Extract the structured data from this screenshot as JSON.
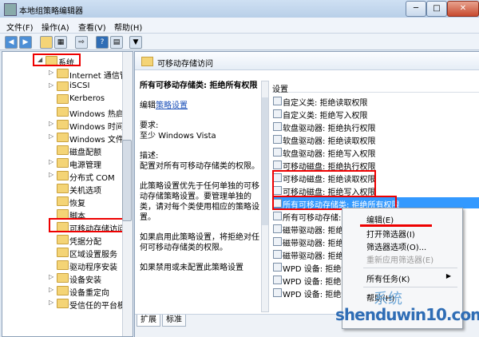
{
  "window": {
    "title": "本地组策略编辑器",
    "min_label": "─",
    "max_label": "□",
    "close_label": "✕"
  },
  "menu": [
    "文件(F)",
    "操作(A)",
    "查看(V)",
    "帮助(H)"
  ],
  "toolbar": [
    "back-icon",
    "forward-icon",
    "up-folder-icon",
    "show-hide-tree-icon",
    "export-icon",
    "help-icon",
    "properties-icon",
    "filter-icon"
  ],
  "tree": {
    "items": [
      {
        "label": "系统",
        "arrow": "◢"
      },
      {
        "label": "Internet 通信管",
        "arrow": "▷"
      },
      {
        "label": "iSCSI",
        "arrow": "▷"
      },
      {
        "label": "Kerberos",
        "arrow": ""
      },
      {
        "label": "Windows 热启",
        "arrow": ""
      },
      {
        "label": "Windows 时间",
        "arrow": "▷"
      },
      {
        "label": "Windows 文件",
        "arrow": "▷"
      },
      {
        "label": "磁盘配额",
        "arrow": ""
      },
      {
        "label": "电源管理",
        "arrow": "▷"
      },
      {
        "label": "分布式 COM",
        "arrow": "▷"
      },
      {
        "label": "关机选项",
        "arrow": ""
      },
      {
        "label": "恢复",
        "arrow": ""
      },
      {
        "label": "脚本",
        "arrow": ""
      },
      {
        "label": "可移动存储访问",
        "arrow": ""
      },
      {
        "label": "凭据分配",
        "arrow": ""
      },
      {
        "label": "区域设置服务",
        "arrow": ""
      },
      {
        "label": "驱动程序安装",
        "arrow": ""
      },
      {
        "label": "设备安装",
        "arrow": "▷"
      },
      {
        "label": "设备重定向",
        "arrow": "▷"
      },
      {
        "label": "受信任的平台模",
        "arrow": "▷"
      }
    ]
  },
  "detail": {
    "header": "可移动存储访问",
    "desc_title": "所有可移动存储类: 拒绝所有权限",
    "edit_prefix": "编辑",
    "edit_link": "策略设置",
    "req_label": "要求:",
    "req_value": "至少 Windows Vista",
    "desc_label": "描述:",
    "desc_text": "配置对所有可移动存储类的权限。",
    "desc_p2": "此策略设置优先于任何单独的可移动存储策略设置。要管理单独的类，请对每个类使用相应的策略设置。",
    "desc_p3": "如果启用此策略设置，将拒绝对任何可移动存储类的权限。",
    "desc_p4": "如果禁用或未配置此策略设置",
    "settings_header": "设置",
    "settings": [
      "自定义类: 拒绝读取权限",
      "自定义类: 拒绝写入权限",
      "软盘驱动器: 拒绝执行权限",
      "软盘驱动器: 拒绝读取权限",
      "软盘驱动器: 拒绝写入权限",
      "可移动磁盘: 拒绝执行权限",
      "可移动磁盘: 拒绝读取权限",
      "可移动磁盘: 拒绝写入权限",
      "所有可移动存储类: 拒绝所有权限",
      "所有可移动存储: 允",
      "磁带驱动器: 拒绝执",
      "磁带驱动器: 拒绝读",
      "磁带驱动器: 拒绝写",
      "WPD 设备: 拒绝读取",
      "WPD 设备: 拒绝写入",
      "WPD 设备: 拒绝读取"
    ],
    "tabs": [
      "扩展",
      "标准"
    ]
  },
  "context_menu": {
    "items": [
      {
        "label": "编辑(E)",
        "disabled": false
      },
      {
        "label": "打开筛选器(I)",
        "disabled": false
      },
      {
        "label": "筛选器选项(O)...",
        "disabled": false
      },
      {
        "label": "重新应用筛选器(E)",
        "disabled": true
      },
      {
        "label": "所有任务(K)",
        "disabled": false
      },
      {
        "label": "帮助(H)",
        "disabled": false
      }
    ],
    "submenu_arrow": "▶"
  },
  "watermark": {
    "main": "shenduwin10.com",
    "brand": "系统"
  }
}
